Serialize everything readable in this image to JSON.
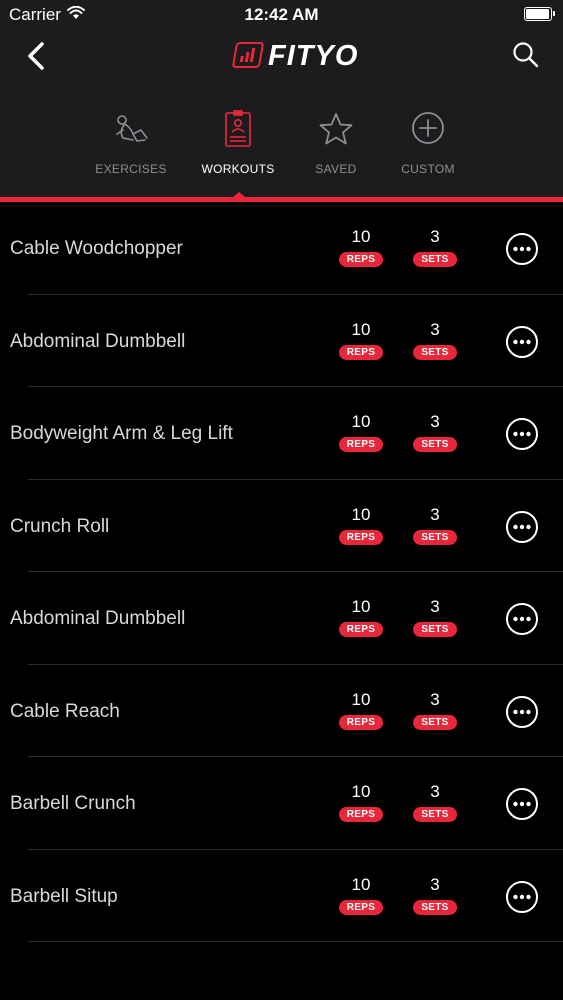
{
  "status_bar": {
    "carrier": "Carrier",
    "time": "12:42 AM"
  },
  "nav": {
    "logo_text": "FITYO",
    "back_icon": "chevron-left-icon",
    "search_icon": "search-icon"
  },
  "tabs": [
    {
      "label": "EXERCISES",
      "icon": "situp-icon",
      "active": false
    },
    {
      "label": "WORKOUTS",
      "icon": "clipboard-icon",
      "active": true
    },
    {
      "label": "SAVED",
      "icon": "star-icon",
      "active": false
    },
    {
      "label": "CUSTOM",
      "icon": "plus-circle-icon",
      "active": false
    }
  ],
  "colors": {
    "accent": "#e8283a",
    "header_bg": "#1c1c1e",
    "list_bg": "#000000",
    "inactive_text": "#8e8e93"
  },
  "workouts": [
    {
      "name": "Cable Woodchopper",
      "reps": "10",
      "reps_label": "REPS",
      "sets": "3",
      "sets_label": "SETS"
    },
    {
      "name": "Abdominal Dumbbell",
      "reps": "10",
      "reps_label": "REPS",
      "sets": "3",
      "sets_label": "SETS"
    },
    {
      "name": "Bodyweight Arm & Leg Lift",
      "reps": "10",
      "reps_label": "REPS",
      "sets": "3",
      "sets_label": "SETS"
    },
    {
      "name": "Crunch Roll",
      "reps": "10",
      "reps_label": "REPS",
      "sets": "3",
      "sets_label": "SETS"
    },
    {
      "name": "Abdominal Dumbbell",
      "reps": "10",
      "reps_label": "REPS",
      "sets": "3",
      "sets_label": "SETS"
    },
    {
      "name": "Cable Reach",
      "reps": "10",
      "reps_label": "REPS",
      "sets": "3",
      "sets_label": "SETS"
    },
    {
      "name": "Barbell Crunch",
      "reps": "10",
      "reps_label": "REPS",
      "sets": "3",
      "sets_label": "SETS"
    },
    {
      "name": "Barbell Situp",
      "reps": "10",
      "reps_label": "REPS",
      "sets": "3",
      "sets_label": "SETS"
    }
  ]
}
